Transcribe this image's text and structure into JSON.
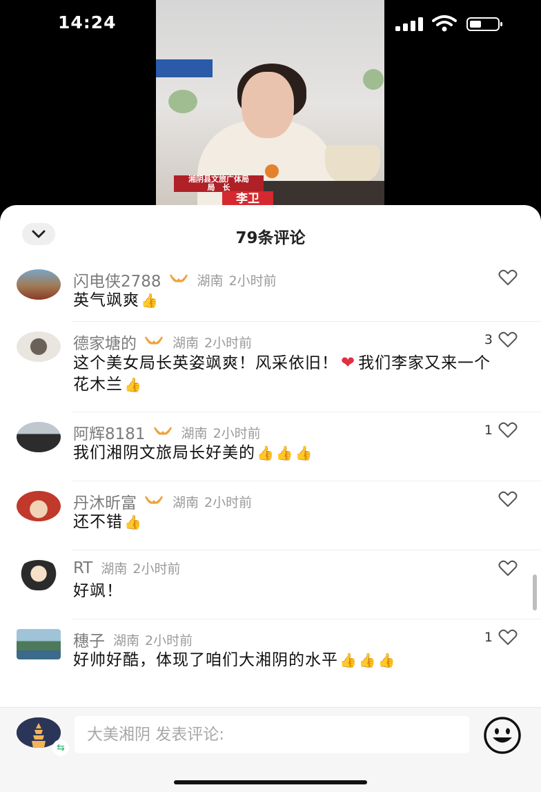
{
  "status_bar": {
    "time": "14:24"
  },
  "video": {
    "caption_org": "湘阴县文旅广体局",
    "caption_role": "局　长",
    "caption_name": "李卫"
  },
  "comments_panel": {
    "title": "79条评论"
  },
  "comments": [
    {
      "user": "闪电侠2788",
      "vip": true,
      "location": "湖南",
      "time": "2小时前",
      "text": "英气飒爽",
      "thumbs": 1,
      "likes": ""
    },
    {
      "user": "德家塘的",
      "vip": true,
      "location": "湖南",
      "time": "2小时前",
      "text_before": "这个美女局长英姿飒爽！风采依旧！",
      "text_after": "我们李家又来一个花木兰",
      "thumbs": 1,
      "likes": "3"
    },
    {
      "user": "阿辉8181",
      "vip": true,
      "location": "湖南",
      "time": "2小时前",
      "text": "我们湘阴文旅局长好美的",
      "thumbs": 3,
      "likes": "1"
    },
    {
      "user": "丹沐昕富",
      "vip": true,
      "location": "湖南",
      "time": "2小时前",
      "text": "还不错",
      "thumbs": 1,
      "likes": ""
    },
    {
      "user": "RT",
      "vip": false,
      "location": "湖南",
      "time": "2小时前",
      "text": "好飒！",
      "thumbs": 0,
      "likes": ""
    },
    {
      "user": "穗子",
      "vip": false,
      "location": "湖南",
      "time": "2小时前",
      "text": "好帅好酷，体现了咱们大湘阴的水平",
      "thumbs": 3,
      "likes": "1"
    }
  ],
  "composer": {
    "placeholder": "大美湘阴 发表评论:"
  },
  "icons": {
    "collapse": "chevron-down-icon",
    "like": "heart-outline-icon",
    "vip": "vip-badge-icon",
    "emoji": "smiley-icon",
    "thumb": "thumbs-up-emoji",
    "accent_vip": "#f0a13a"
  }
}
